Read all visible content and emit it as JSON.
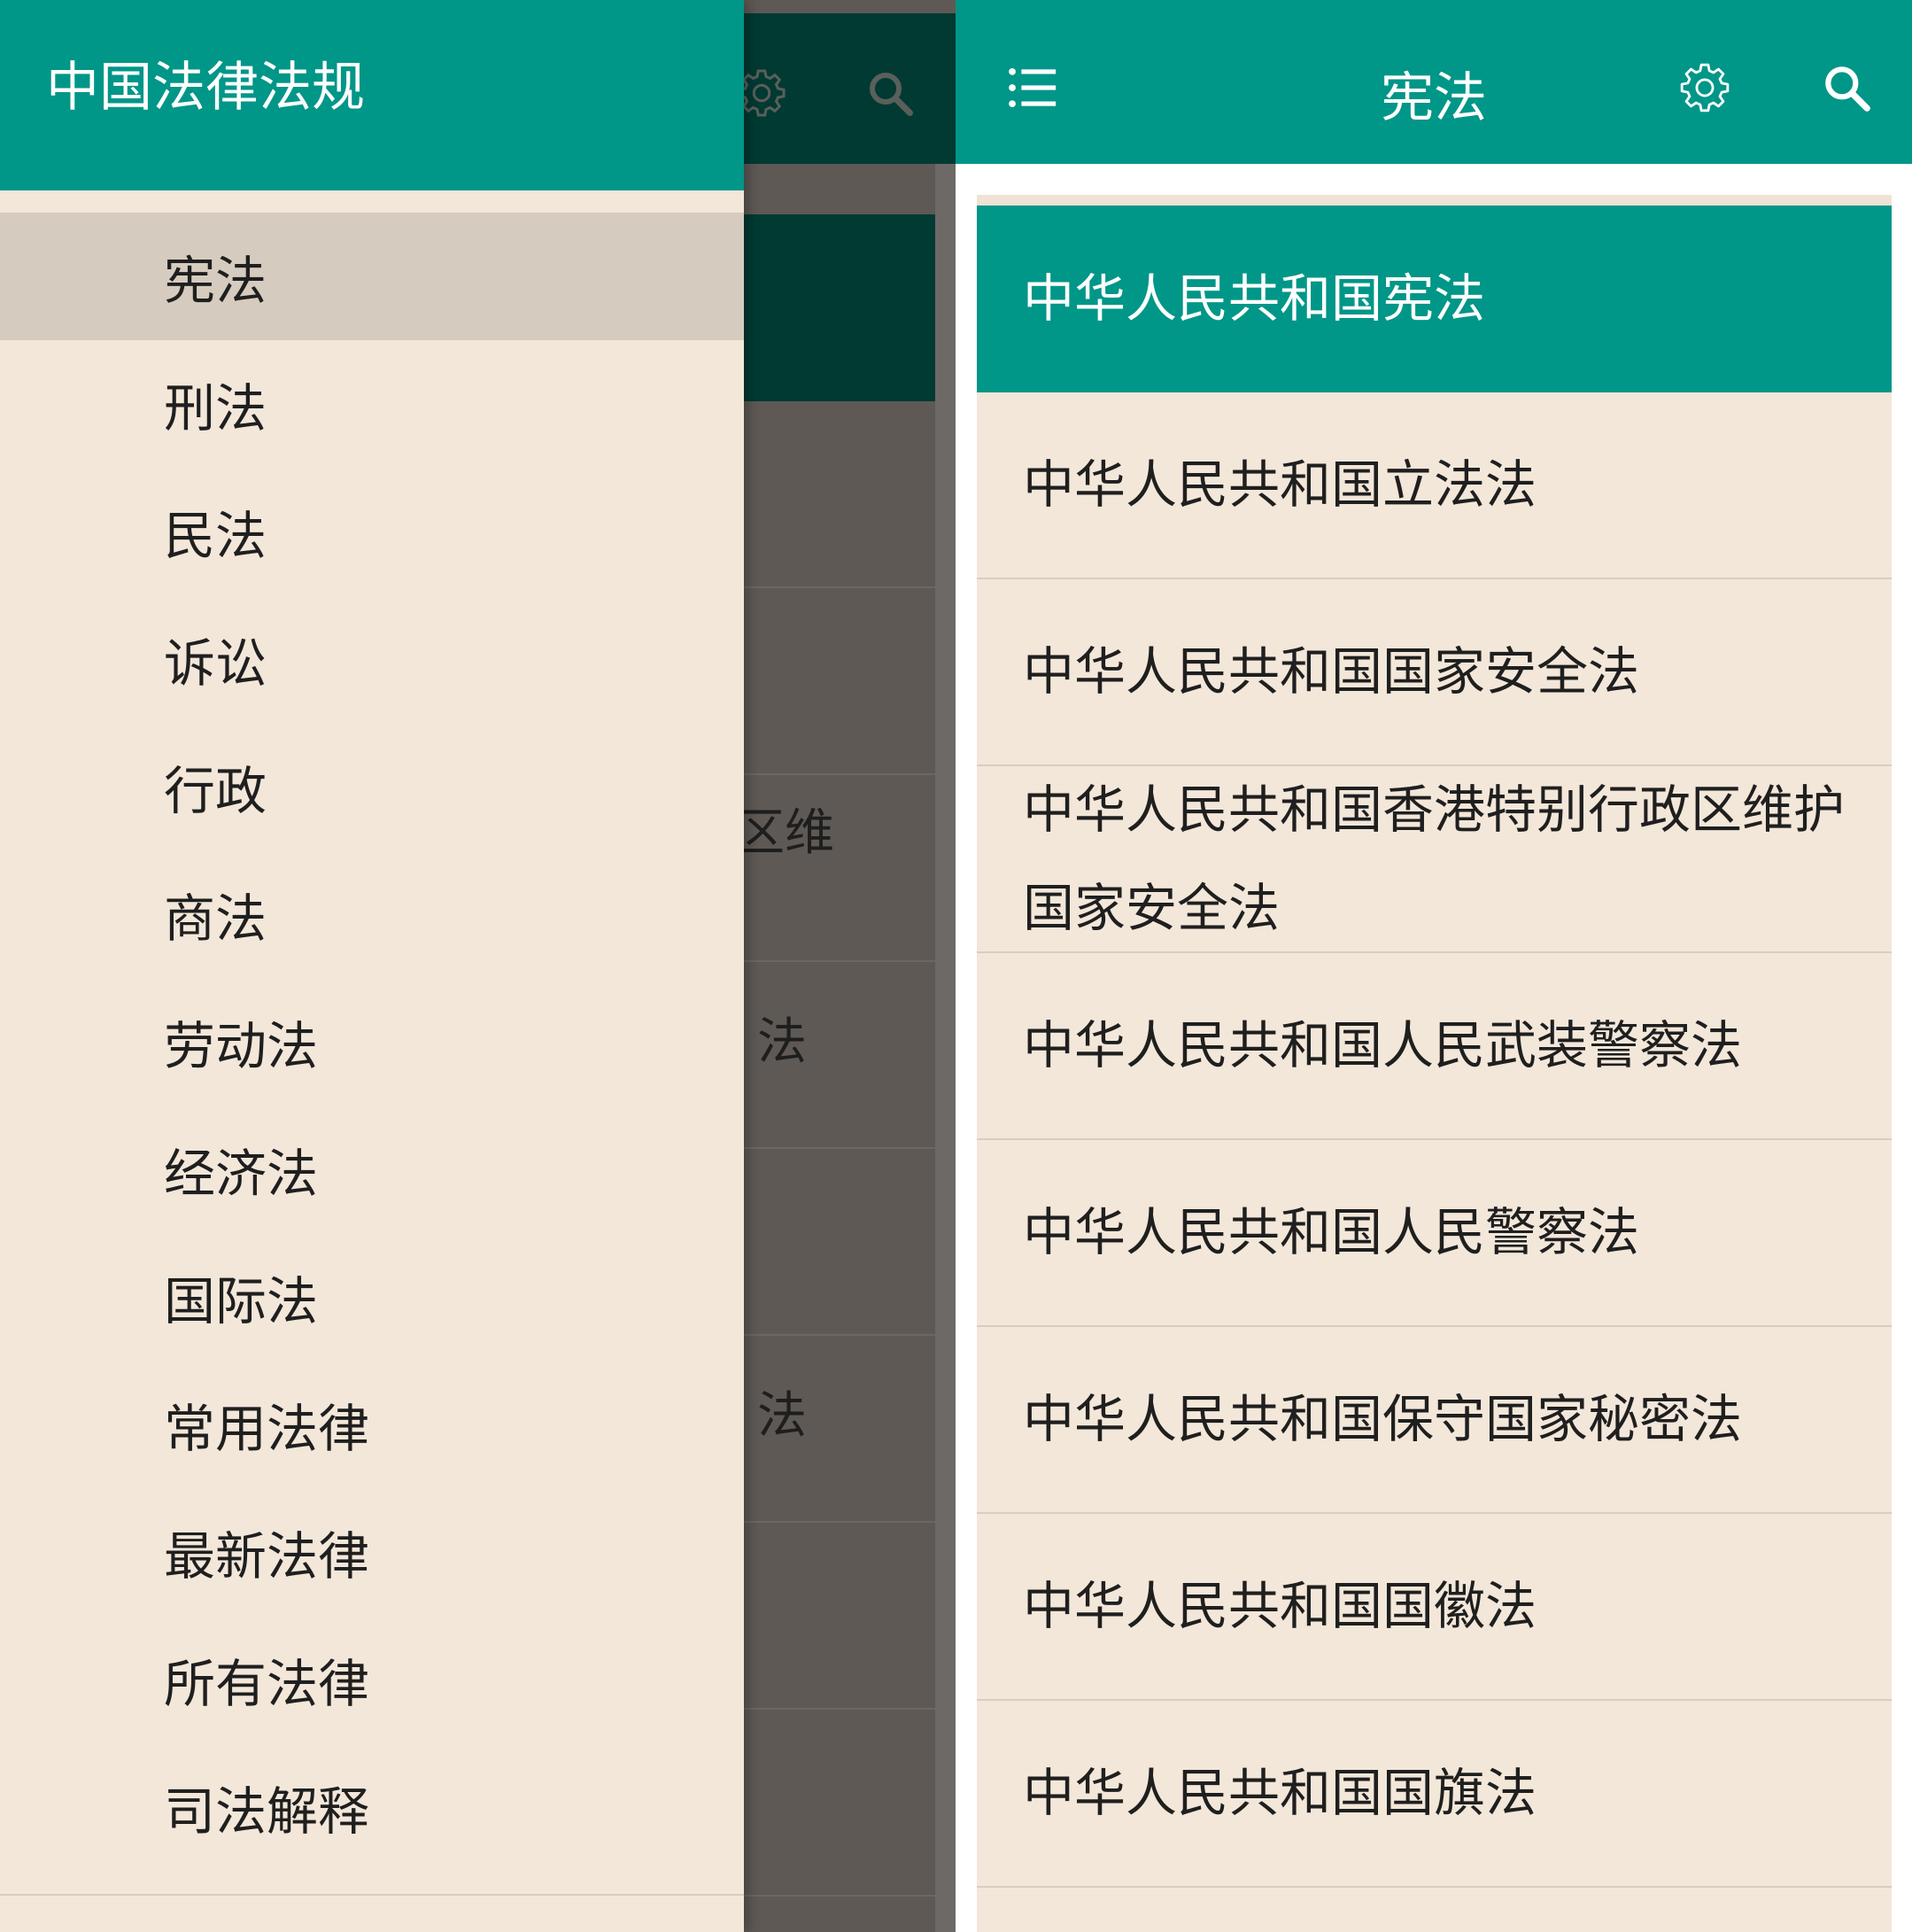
{
  "drawer": {
    "title": "中国法律法规",
    "items": [
      {
        "label": "宪法",
        "active": true
      },
      {
        "label": "刑法"
      },
      {
        "label": "民法"
      },
      {
        "label": "诉讼"
      },
      {
        "label": "行政"
      },
      {
        "label": "商法"
      },
      {
        "label": "劳动法"
      },
      {
        "label": "经济法"
      },
      {
        "label": "国际法"
      },
      {
        "label": "常用法律"
      },
      {
        "label": "最新法律"
      },
      {
        "label": "所有法律"
      },
      {
        "label": "司法解释"
      }
    ]
  },
  "background_peek": {
    "row4_text": "区维",
    "row5_text": "法",
    "row7_text": "法"
  },
  "appbar": {
    "title": "宪法",
    "icons": [
      "menu-icon",
      "gear-icon",
      "search-icon"
    ]
  },
  "laws": [
    "中华人民共和国宪法",
    "中华人民共和国立法法",
    "中华人民共和国国家安全法",
    "中华人民共和国香港特别行政区维护国家安全法",
    "中华人民共和国人民武装警察法",
    "中华人民共和国人民警察法",
    "中华人民共和国保守国家秘密法",
    "中华人民共和国国徽法",
    "中华人民共和国国旗法"
  ],
  "colors": {
    "primary": "#009688",
    "list_background": "#f3e7da",
    "drawer_active": "#d6cbbf",
    "scrim_appbar": "#003a33",
    "scrim_list": "#5e5955"
  }
}
